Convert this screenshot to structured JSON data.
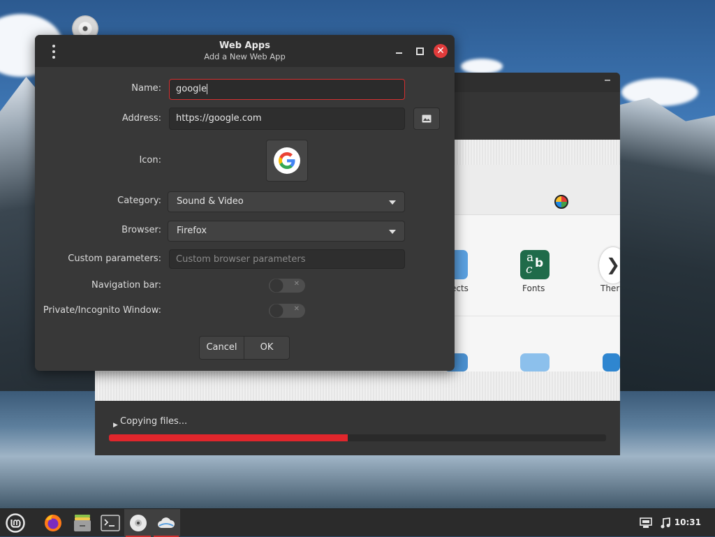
{
  "dialog": {
    "title": "Web Apps",
    "subtitle": "Add a New Web App",
    "window_controls": {
      "menu_icon": "kebab-menu-icon",
      "minimize_icon": "minimize-icon",
      "maximize_icon": "maximize-icon",
      "close_icon": "close-icon"
    },
    "form": {
      "name": {
        "label": "Name:",
        "value": "google"
      },
      "address": {
        "label": "Address:",
        "value": "https://google.com",
        "button_icon": "image-icon"
      },
      "icon": {
        "label": "Icon:",
        "icon": "google-g-logo-icon"
      },
      "category": {
        "label": "Category:",
        "selected": "Sound & Video"
      },
      "browser": {
        "label": "Browser:",
        "selected": "Firefox"
      },
      "custom_parameters": {
        "label": "Custom parameters:",
        "value": "",
        "placeholder": "Custom browser parameters"
      },
      "navigation_bar": {
        "label": "Navigation bar:",
        "enabled": false
      },
      "private_window": {
        "label": "Private/Incognito Window:",
        "enabled": false
      }
    },
    "buttons": {
      "cancel": "Cancel",
      "ok": "OK"
    }
  },
  "background_window": {
    "apps": [
      {
        "label": "ects",
        "icon": "objects-icon"
      },
      {
        "label": "Fonts",
        "icon": "fonts-icon"
      },
      {
        "label": "Ther",
        "icon": "themes-icon"
      }
    ],
    "status": {
      "text": "Copying files...",
      "progress": 0.48
    }
  },
  "taskbar": {
    "items": [
      {
        "name": "menu",
        "icon": "linux-mint-menu-icon"
      },
      {
        "name": "firefox",
        "icon": "firefox-icon"
      },
      {
        "name": "files",
        "icon": "file-manager-icon"
      },
      {
        "name": "terminal",
        "icon": "terminal-icon"
      },
      {
        "name": "disc",
        "icon": "disc-icon"
      },
      {
        "name": "webapps",
        "icon": "cloud-webapps-icon"
      }
    ],
    "tray": {
      "network_icon": "network-icon",
      "sound_icon": "music-note-icon",
      "time": "10:31"
    }
  },
  "colors": {
    "accent": "#d32f2f",
    "progress": "#e0262c",
    "dialog_bg": "#383838",
    "titlebar_bg": "#2d2d2d"
  }
}
